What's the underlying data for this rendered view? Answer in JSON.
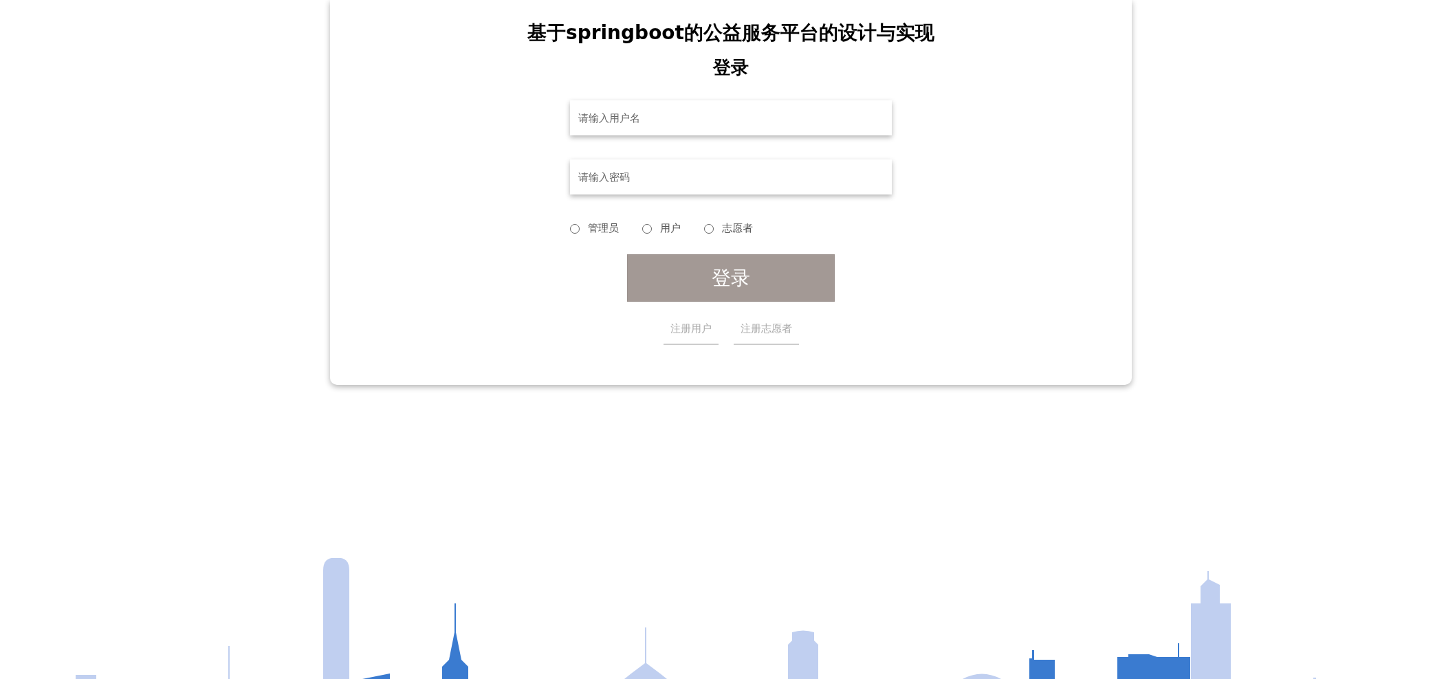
{
  "title": "基于springboot的公益服务平台的设计与实现",
  "heading": "登录",
  "fields": [
    {
      "placeholder": "请输入用户名"
    },
    {
      "placeholder": "请输入密码"
    }
  ],
  "roles": [
    {
      "label": "管理员",
      "selected": false
    },
    {
      "label": "用户",
      "selected": false
    },
    {
      "label": "志愿者",
      "selected": false
    }
  ],
  "login_button": "登录",
  "links": [
    "注册用户",
    "注册志愿者"
  ]
}
